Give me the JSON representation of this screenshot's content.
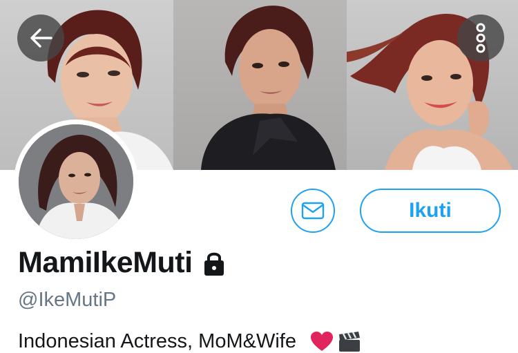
{
  "header": {
    "back_icon": "arrow-left-icon",
    "more_icon": "vertical-dots-icon"
  },
  "profile": {
    "display_name": "MamiIkeMuti",
    "lock_icon": "lock-icon",
    "handle": "@IkeMutiP",
    "bio": "Indonesian Actress, MoM&Wife"
  },
  "actions": {
    "message_icon": "envelope-icon",
    "follow_label": "Ikuti"
  },
  "colors": {
    "accent": "#1da1f2",
    "text_primary": "#14171a",
    "text_secondary": "#657786"
  }
}
